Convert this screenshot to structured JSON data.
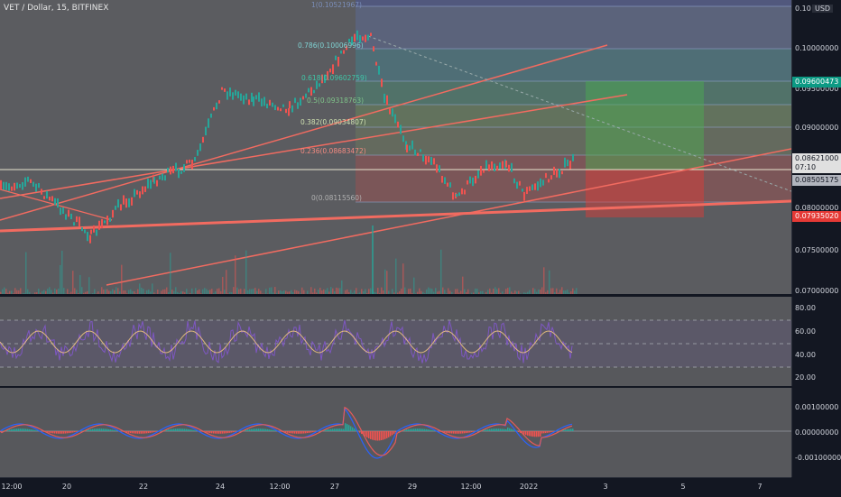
{
  "header": {
    "symbol_title": "VET / Dollar, 15, BITFINEX",
    "currency": "USD"
  },
  "price_axis": {
    "ticks": [
      "0.10",
      "0.10000000",
      "0.09500000",
      "0.09000000",
      "0.08000000",
      "0.07500000",
      "0.07000000"
    ],
    "tags": {
      "target": "0.09600473",
      "current_price": "0.08621000",
      "countdown": "07:10",
      "entry": "0.08505175",
      "stop": "0.07935020"
    }
  },
  "fib_levels": {
    "level_1": "1(0.10521967)",
    "level_0786": "0.786(0.10006996)",
    "level_0618": "0.618(0.09602759)",
    "level_05": "0.5(0.09318763)",
    "level_0382": "0.382(0.09034807)",
    "level_0236": "0.236(0.08683472)",
    "level_0": "0(0.08115560)"
  },
  "rsi_axis": {
    "ticks": [
      "80.00",
      "60.00",
      "40.00",
      "20.00"
    ]
  },
  "macd_axis": {
    "ticks": [
      "0.00100000",
      "0.00000000",
      "-0.00100000"
    ]
  },
  "time_axis": {
    "ticks": [
      "12:00",
      "20",
      "22",
      "24",
      "12:00",
      "27",
      "29",
      "12:00",
      "2022",
      "3",
      "5",
      "7"
    ]
  },
  "colors": {
    "background": "#131722",
    "pane": "#5b5c60",
    "trendline": "#f26b60",
    "fib_zone_green": "#4caf50",
    "fib_zone_red": "#e53935",
    "target_tag": "#0c9a84",
    "stop_tag": "#e53935",
    "rsi_line": "#7e57c2",
    "rsi_signal": "#ffd180",
    "macd_line": "#2962ff",
    "macd_signal": "#e65a5a"
  }
}
